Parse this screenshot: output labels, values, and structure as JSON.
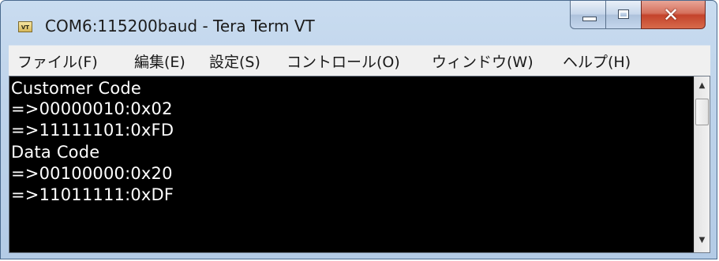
{
  "window": {
    "title": "COM6:115200baud - Tera Term VT",
    "icon": "VT"
  },
  "caption_buttons": {
    "minimize": "minimize-icon",
    "maximize": "maximize-icon",
    "close": "close-icon"
  },
  "menu": {
    "items": [
      {
        "label": "ファイル(F)"
      },
      {
        "label": "編集(E)"
      },
      {
        "label": "設定(S)"
      },
      {
        "label": "コントロール(O)"
      },
      {
        "label": "ウィンドウ(W)"
      },
      {
        "label": "ヘルプ(H)"
      }
    ]
  },
  "terminal": {
    "lines": [
      "Customer Code",
      "=>00000010:0x02",
      "=>11111101:0xFD",
      "Data Code",
      "=>00100000:0x20",
      "=>11011111:0xDF"
    ]
  },
  "scrollbar": {
    "up_icon": "scroll-up-arrow-icon",
    "down_icon": "scroll-down-arrow-icon"
  },
  "colors": {
    "terminal_background": "#000000",
    "terminal_text": "#ffffff",
    "close_button": "#c4432b",
    "title_bar": "#bed3ea"
  }
}
